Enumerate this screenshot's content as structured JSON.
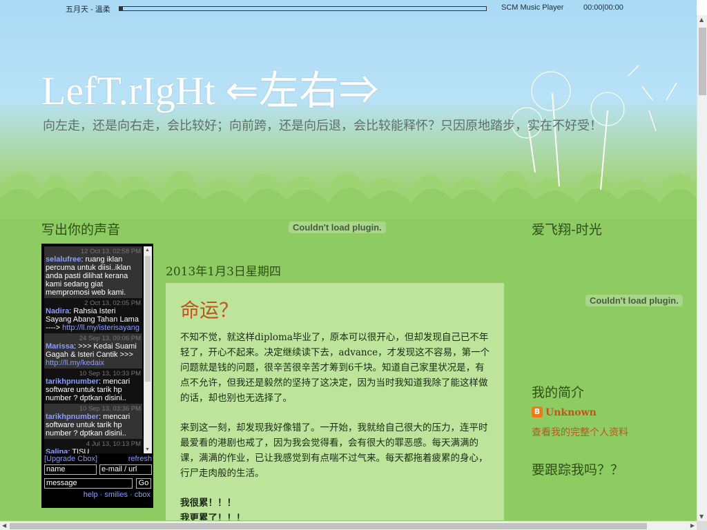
{
  "player": {
    "song": "五月天 - 溫柔",
    "name": "SCM Music Player",
    "time": "00:00|00:00",
    "progress": 0
  },
  "header": {
    "title": "LefT.rIgHt ⇐左右⇒",
    "description": "向左走，还是向右走，会比较好；向前跨，还是向后退，会比较能释怀？只因原地踏步，实在不好受！"
  },
  "left_sidebar": {
    "title": "写出你的声音",
    "cbox": {
      "messages": [
        {
          "date": "12 Oct 13, 02:58 PM",
          "name": "selalufree",
          "text": ": ruang iklan percuma untuk diisi..iklan anda pasti dilihat kerana kami sedang giat mempromosi web kami.",
          "link": ""
        },
        {
          "date": "2 Oct 13, 02:05 PM",
          "name": "Nadira",
          "text": ": Rahsia Isteri Sayang Abang Tahan Lama ----> ",
          "link": "http://ll.my/isterisayang"
        },
        {
          "date": "24 Sep 13, 09:06 PM",
          "name": "Marissa",
          "text": ": >>> Kedai Suami Gagah & Isteri Cantik >>> ",
          "link": "http://ll.my/kedaix"
        },
        {
          "date": "10 Sep 13, 10:33 PM",
          "name": "tarikhpnumber",
          "text": ": mencari software untuk tarik hp number ? dptkan disini..",
          "link": ""
        },
        {
          "date": "10 Sep 13, 03:36 PM",
          "name": "tarikhpnumber",
          "text": ": mencari software untuk tarik hp number ? dptkan disini..",
          "link": ""
        },
        {
          "date": "4 Jul 13, 10:13 PM",
          "name": "Salina",
          "text": ": TISU SUPERMAGICPOWER",
          "link": ""
        }
      ],
      "upgrade_label": "[Upgrade Cbox]",
      "refresh_label": "refresh",
      "name_value": "name",
      "email_value": "e-mail / url",
      "message_value": "message",
      "go_label": "Go",
      "footer_links": "help · smilies · cbox"
    }
  },
  "main": {
    "plugin_message": "Couldn't load plugin.",
    "date_header": "2013年1月3日星期四",
    "post": {
      "title": "命运？",
      "paragraph1": "不知不觉，就这样diploma毕业了，原本可以很开心，但却发现自己已不年轻了，开心不起来。决定继续读下去，advance，才发现这不容易，第一个问题就是钱的问题，很辛苦很辛苦才筹到6千块。知道自己家里状况是，有点不允许，但我还是毅然的坚持了这决定，因为当时我知道我除了能这样做的话，却也别也无选择了。",
      "paragraph2": "来到这一刻，却发现我好像错了。一开始，我就给自己很大的压力，连平时最爱看的港剧也戒了，因为我会觉得看，会有很大的罪恶感。每天满满的课，满满的作业，已让我感觉到有点喘不过气来。每天都拖着疲累的身心，行尸走肉般的生活。",
      "line3": "我很累！！！",
      "line4": "我更累了！！！"
    }
  },
  "right_sidebar": {
    "title1": "爱飞翔-时光",
    "plugin_message": "Couldn't load plugin.",
    "title2": "我的简介",
    "profile_name": "Unknown",
    "profile_link": "查看我的完整个人资料",
    "title3": "要跟踪我吗？？"
  },
  "colors": {
    "sky": "#a9d9f4",
    "grass": "#8ecb62",
    "post_bg": "#bde49a",
    "accent": "#c0541f",
    "heading": "#2e4f14"
  }
}
